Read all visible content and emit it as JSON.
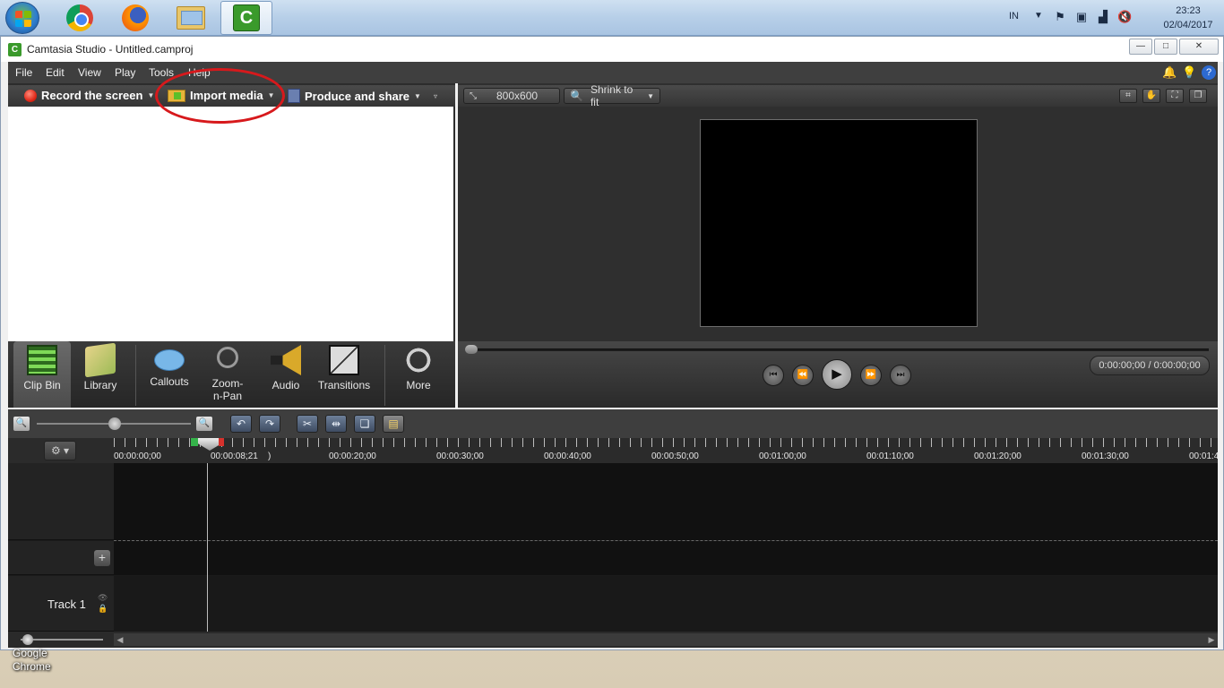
{
  "taskbar": {
    "apps": [
      {
        "name": "start",
        "icon": "windows-start-icon"
      },
      {
        "name": "chrome",
        "icon": "chrome-icon"
      },
      {
        "name": "firefox",
        "icon": "firefox-icon"
      },
      {
        "name": "explorer",
        "icon": "folder-icon"
      },
      {
        "name": "camtasia",
        "icon": "camtasia-icon",
        "active": true
      }
    ],
    "tray": {
      "language": "IN",
      "time": "23:23",
      "date": "02/04/2017"
    }
  },
  "window": {
    "title": "Camtasia Studio - Untitled.camproj",
    "controls": {
      "minimize": "—",
      "maximize": "□",
      "close": "✕"
    }
  },
  "menu": [
    "File",
    "Edit",
    "View",
    "Play",
    "Tools",
    "Help"
  ],
  "tasks": {
    "record": "Record the screen",
    "import": "Import media",
    "produce": "Produce and share"
  },
  "tabs": [
    {
      "label": "Clip Bin",
      "icon": "film-strip-icon",
      "active": true
    },
    {
      "label": "Library",
      "icon": "library-folder-icon"
    },
    {
      "label": "Callouts",
      "icon": "speech-bubble-icon"
    },
    {
      "label": "Zoom-n-Pan",
      "icon": "magnifier-icon"
    },
    {
      "label": "Audio",
      "icon": "speaker-icon"
    },
    {
      "label": "Transitions",
      "icon": "transitions-icon"
    },
    {
      "label": "More",
      "icon": "more-dots-icon"
    }
  ],
  "preview": {
    "dimensions": "800x600",
    "zoom": "Shrink to fit",
    "time": "0:00:00;00 / 0:00:00;00"
  },
  "timeline": {
    "ticks": [
      "00:00:00;00",
      "00:00:08;21",
      ")",
      "00:00:20;00",
      "00:00:30;00",
      "00:00:40;00",
      "00:00:50;00",
      "00:01:00;00",
      "00:01:10;00",
      "00:01:20;00",
      "00:01:30;00",
      "00:01:4"
    ],
    "track_name": "Track 1"
  },
  "desktop": {
    "icon_label_1": "Google",
    "icon_label_2": "Chrome"
  }
}
